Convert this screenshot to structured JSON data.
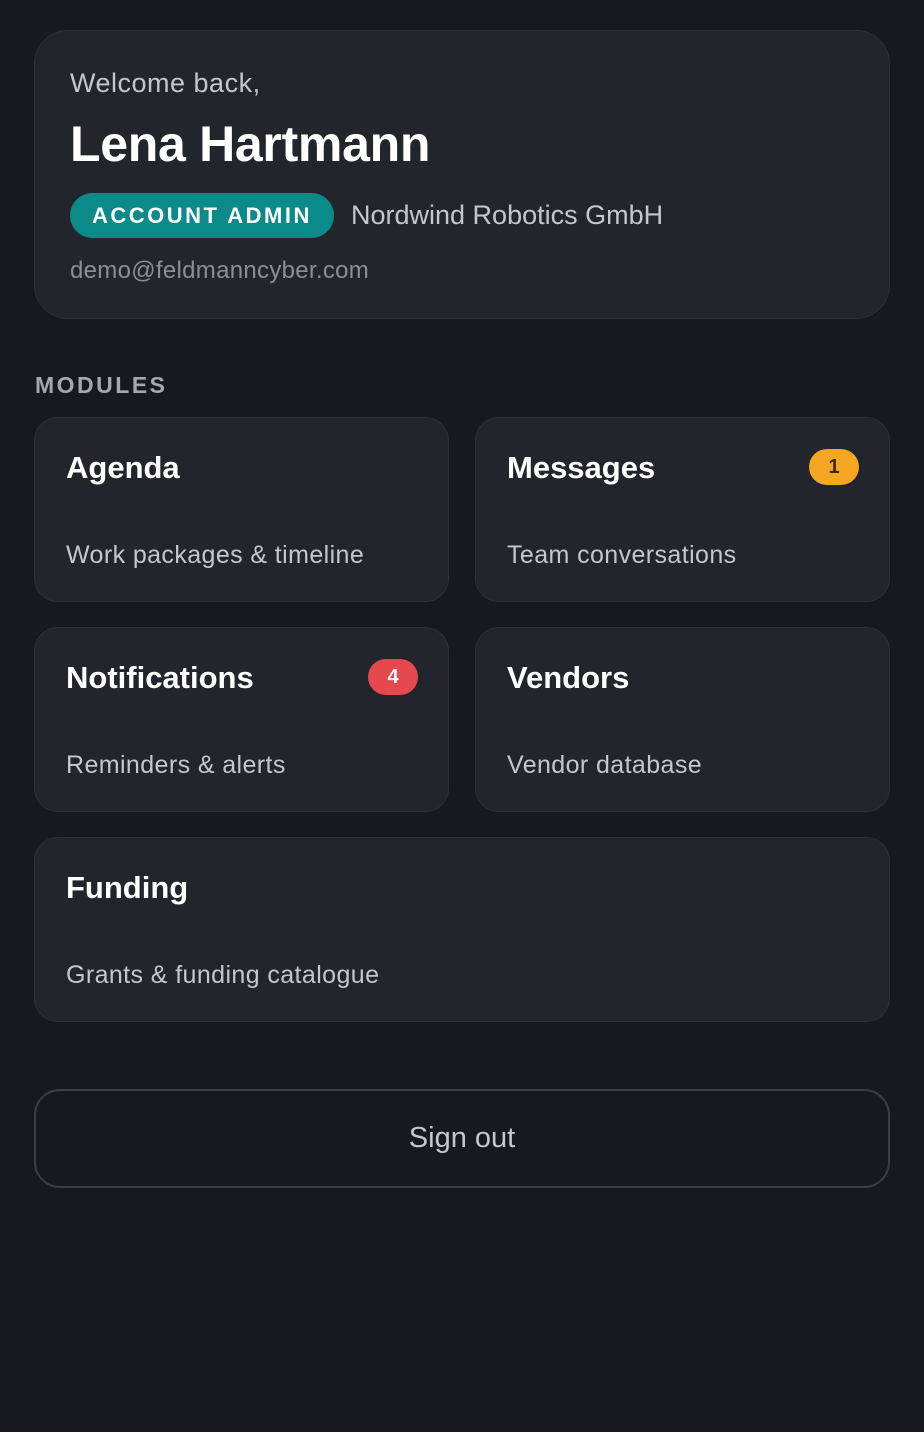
{
  "profile": {
    "welcome": "Welcome back,",
    "name": "Lena Hartmann",
    "role": "ACCOUNT ADMIN",
    "company": "Nordwind Robotics GmbH",
    "email": "demo@feldmanncyber.com"
  },
  "modules": {
    "section_label": "MODULES",
    "agenda": {
      "title": "Agenda",
      "description": "Work packages & timeline"
    },
    "messages": {
      "title": "Messages",
      "description": "Team conversations",
      "badge": "1"
    },
    "notifications": {
      "title": "Notifications",
      "description": "Reminders & alerts",
      "badge": "4"
    },
    "vendors": {
      "title": "Vendors",
      "description": "Vendor database"
    },
    "funding": {
      "title": "Funding",
      "description": "Grants & funding catalogue"
    }
  },
  "actions": {
    "sign_out": "Sign out"
  },
  "colors": {
    "background": "#17191e",
    "card": "#22252c",
    "role_badge": "#0b8a8a",
    "messages_badge": "#f5a623",
    "notifications_badge": "#e5484d"
  }
}
